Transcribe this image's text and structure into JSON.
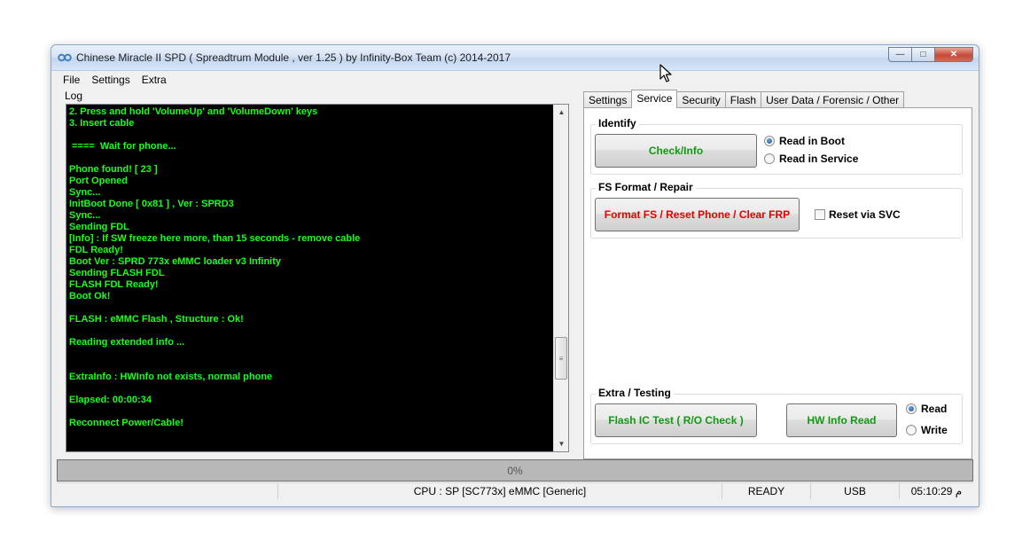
{
  "window": {
    "title": "Chinese Miracle II SPD ( Spreadtrum Module , ver 1.25 ) by Infinity-Box Team (c) 2014-2017",
    "min_glyph": "—",
    "max_glyph": "□",
    "close_glyph": "✕"
  },
  "menu": [
    "File",
    "Settings",
    "Extra"
  ],
  "log": {
    "label": "Log",
    "lines": [
      "2. Press and hold 'VolumeUp' and 'VolumeDown' keys",
      "3. Insert cable",
      "",
      " ====  Wait for phone...",
      "",
      "Phone found! [ 23 ]",
      "Port Opened",
      "Sync...",
      "InitBoot Done [ 0x81 ] , Ver : SPRD3",
      "Sync...",
      "Sending FDL",
      "[Info] : If SW freeze here more, than 15 seconds - remove cable",
      "FDL Ready!",
      "Boot Ver : SPRD 773x eMMC loader v3 Infinity",
      "Sending FLASH FDL",
      "FLASH FDL Ready!",
      "Boot Ok!",
      "",
      "FLASH : eMMC Flash , Structure : Ok!",
      "",
      "Reading extended info ...",
      "",
      "",
      "ExtraInfo : HWInfo not exists, normal phone",
      "",
      "Elapsed: 00:00:34",
      "",
      "Reconnect Power/Cable!"
    ],
    "text_color": "#19ff19",
    "scroll_up_glyph": "▲",
    "scroll_down_glyph": "▼",
    "scroll_thumb_glyph": "≡"
  },
  "tabs": [
    {
      "label": "Settings",
      "active": false
    },
    {
      "label": "Service",
      "active": true
    },
    {
      "label": "Security",
      "active": false
    },
    {
      "label": "Flash",
      "active": false
    },
    {
      "label": "User Data / Forensic / Other",
      "active": false
    }
  ],
  "service": {
    "identify": {
      "title": "Identify",
      "button": "Check/Info",
      "options": [
        {
          "label": "Read in Boot",
          "checked": true
        },
        {
          "label": "Read in Service",
          "checked": false
        }
      ]
    },
    "fs": {
      "title": "FS Format / Repair",
      "button": "Format FS / Reset Phone / Clear FRP",
      "checkbox": "Reset via SVC",
      "checkbox_checked": false
    },
    "extra": {
      "title": "Extra / Testing",
      "button1": "Flash IC Test ( R/O Check )",
      "button2": "HW Info Read",
      "options": [
        {
          "label": "Read",
          "checked": true
        },
        {
          "label": "Write",
          "checked": false
        }
      ]
    }
  },
  "progress": {
    "value_percent": 0,
    "label": "0%"
  },
  "status": {
    "cpu": "CPU : SP [SC773x] eMMC [Generic]",
    "state": "READY",
    "port": "USB",
    "time": "05:10:29 م"
  },
  "colors": {
    "green_button_text": "#129a12",
    "red_button_text": "#e00000",
    "log_background": "#000000"
  }
}
